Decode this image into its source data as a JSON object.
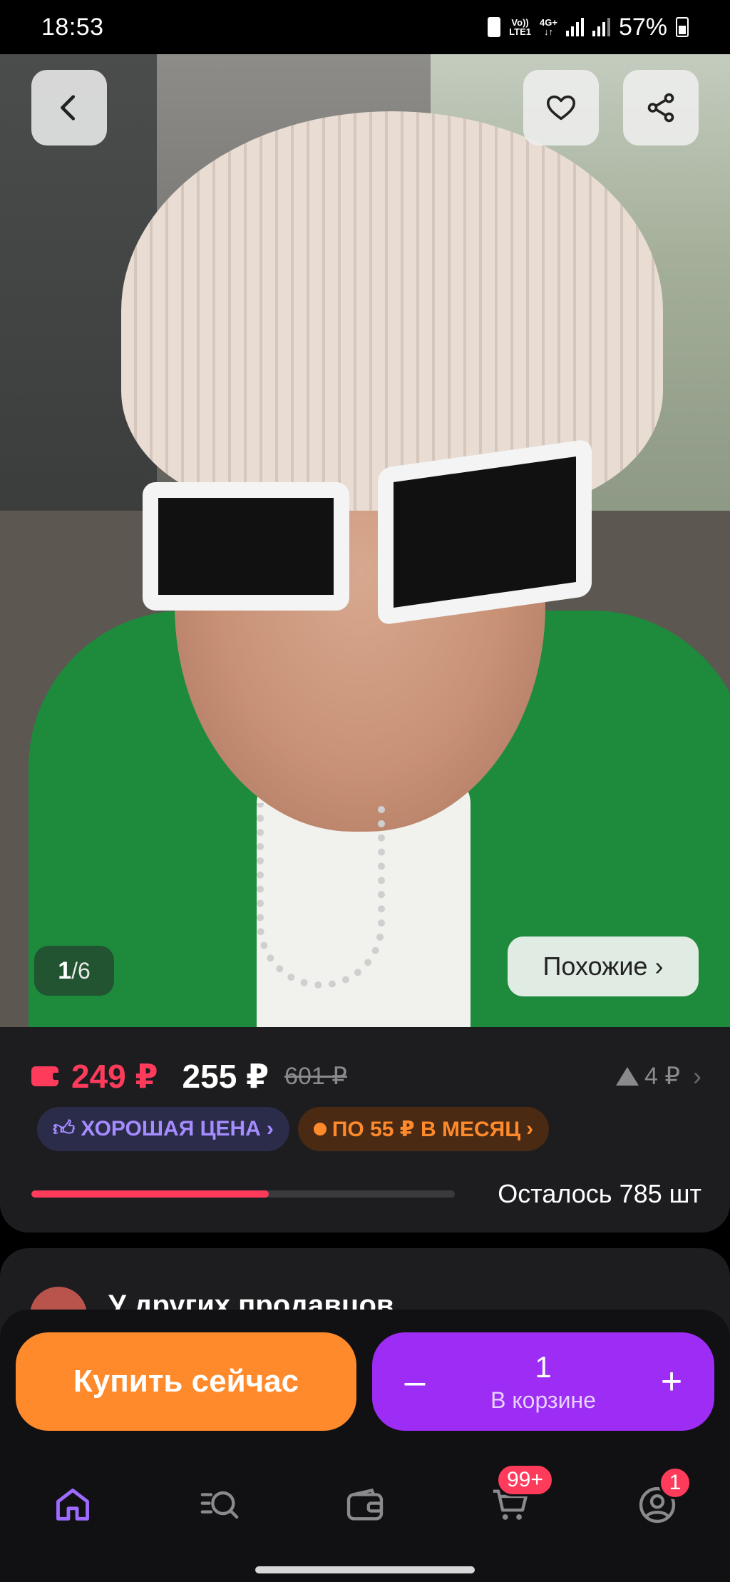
{
  "status_bar": {
    "time": "18:53",
    "network_top": "Vo))",
    "network_bottom": "LTE1",
    "network_type": "4G+",
    "battery_percent": "57%"
  },
  "gallery": {
    "current": "1",
    "separator": "/",
    "total": "6",
    "similar_label": "Похожие",
    "similar_chevron": "›"
  },
  "pricing": {
    "wallet_price": "249 ₽",
    "price": "255 ₽",
    "old_price": "601 ₽",
    "price_change": "4 ₽",
    "chevron": "›",
    "badge_good_price": "ХОРОШАЯ ЦЕНА",
    "badge_installment": "ПО 55 ₽ В МЕСЯЦ",
    "badge_chevron": "›",
    "stock_fraction": 0.56,
    "stock_text": "Осталось 785 шт"
  },
  "other_sellers": {
    "title": "У других продавцов"
  },
  "actions": {
    "buy_now": "Купить сейчас",
    "decrement": "–",
    "quantity": "1",
    "in_cart": "В корзине",
    "increment": "+"
  },
  "nav": {
    "cart_badge": "99+",
    "profile_badge": "1"
  },
  "colors": {
    "accent_red": "#ff3b5c",
    "accent_orange": "#ff8a2b",
    "accent_purple": "#9d2cf5",
    "nav_active": "#9d6bff"
  }
}
